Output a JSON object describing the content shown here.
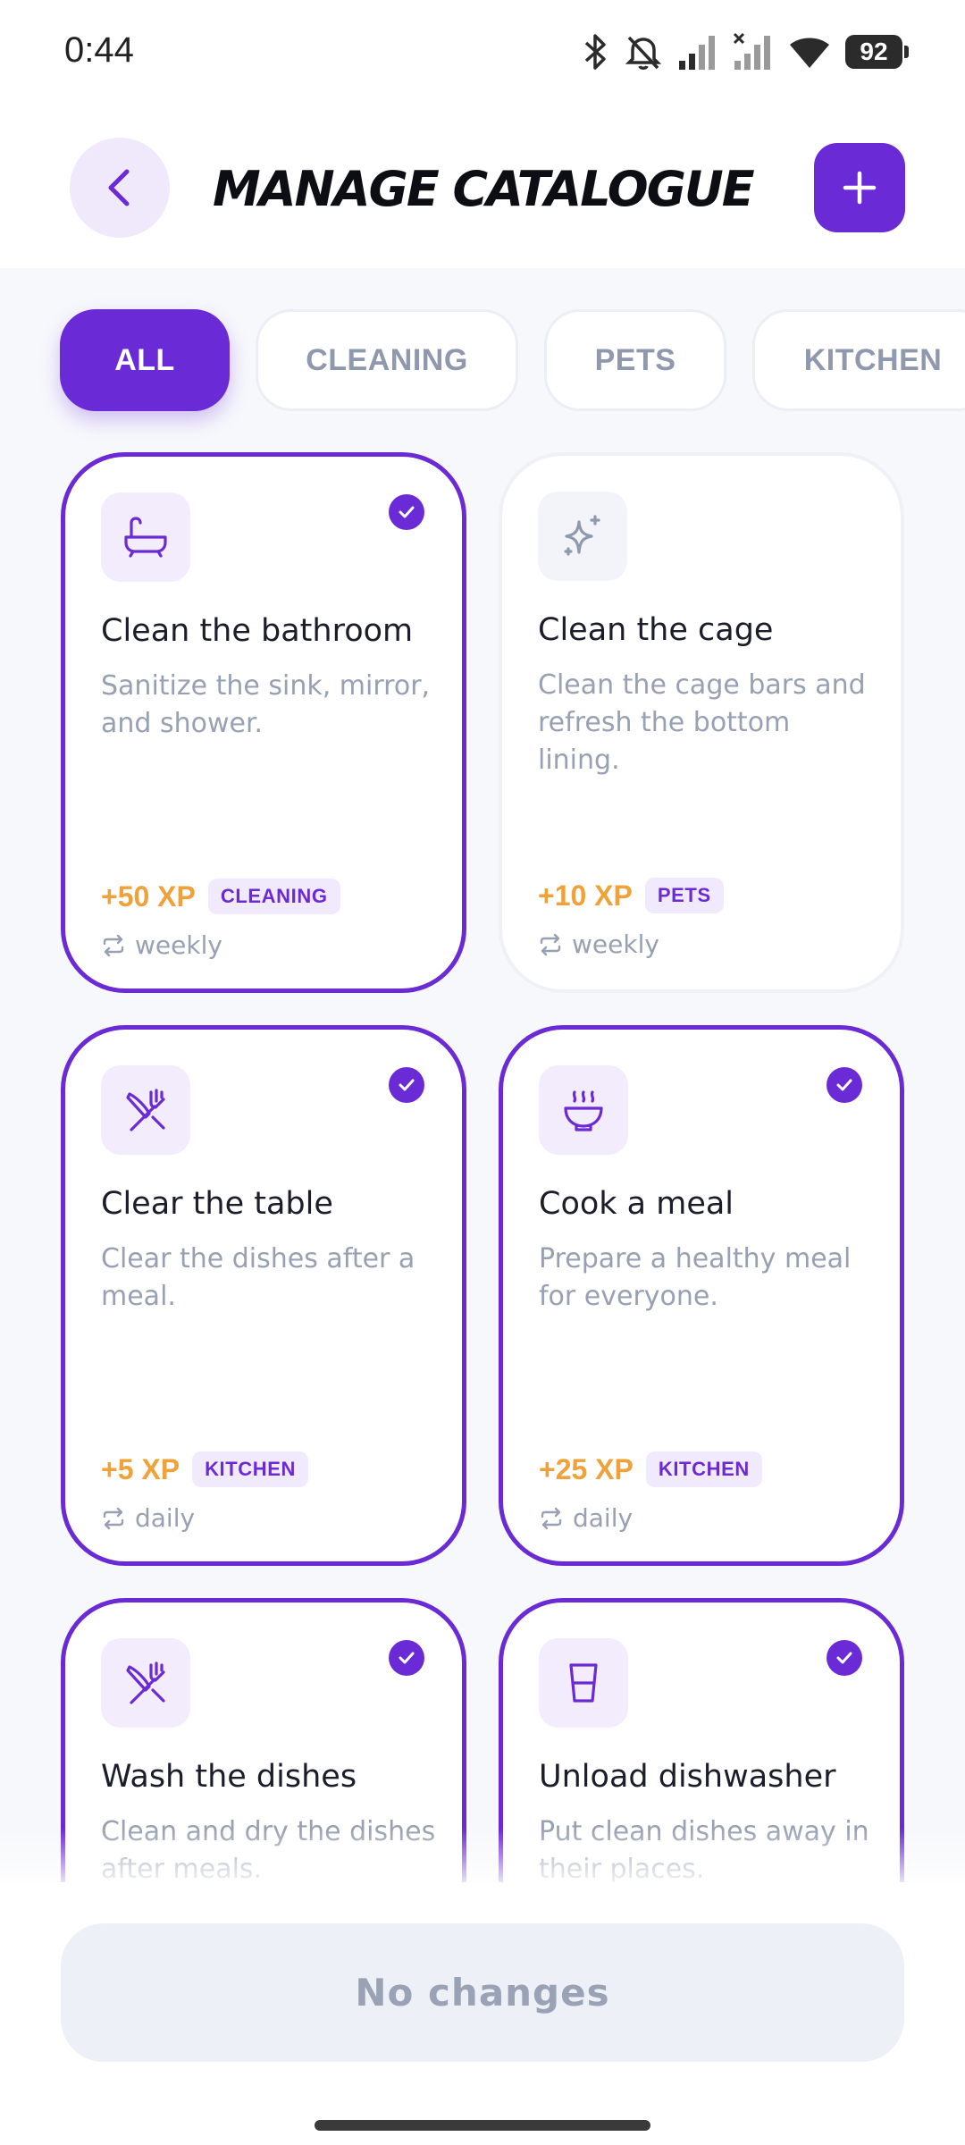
{
  "status_bar": {
    "time": "0:44",
    "battery": "92"
  },
  "header": {
    "title": "MANAGE CATALOGUE"
  },
  "filters": [
    {
      "label": "ALL",
      "active": true
    },
    {
      "label": "CLEANING",
      "active": false
    },
    {
      "label": "PETS",
      "active": false
    },
    {
      "label": "KITCHEN",
      "active": false
    }
  ],
  "cards": [
    {
      "icon": "bathtub-icon",
      "title": "Clean the bathroom",
      "description": "Sanitize the sink, mirror, and shower.",
      "xp": "+50 XP",
      "tag": "CLEANING",
      "frequency": "weekly",
      "selected": true
    },
    {
      "icon": "sparkle-icon",
      "title": "Clean the cage",
      "description": "Clean the cage bars and refresh the bottom lining.",
      "xp": "+10 XP",
      "tag": "PETS",
      "frequency": "weekly",
      "selected": false
    },
    {
      "icon": "utensils-crossed-icon",
      "title": "Clear the table",
      "description": "Clear the dishes after a meal.",
      "xp": "+5 XP",
      "tag": "KITCHEN",
      "frequency": "daily",
      "selected": true
    },
    {
      "icon": "soup-bowl-icon",
      "title": "Cook a meal",
      "description": "Prepare a healthy meal for everyone.",
      "xp": "+25 XP",
      "tag": "KITCHEN",
      "frequency": "daily",
      "selected": true
    },
    {
      "icon": "utensils-crossed-icon",
      "title": "Wash the dishes",
      "description": "Clean and dry the dishes after meals.",
      "xp": "",
      "tag": "",
      "frequency": "",
      "selected": true
    },
    {
      "icon": "glass-icon",
      "title": "Unload dishwasher",
      "description": "Put clean dishes away in their places.",
      "xp": "",
      "tag": "",
      "frequency": "",
      "selected": true
    }
  ],
  "footer": {
    "save_label": "No changes"
  },
  "colors": {
    "accent": "#6a2bd6",
    "xp": "#f0a23a",
    "muted": "#98a0b3",
    "background": "#f7f8fc"
  }
}
